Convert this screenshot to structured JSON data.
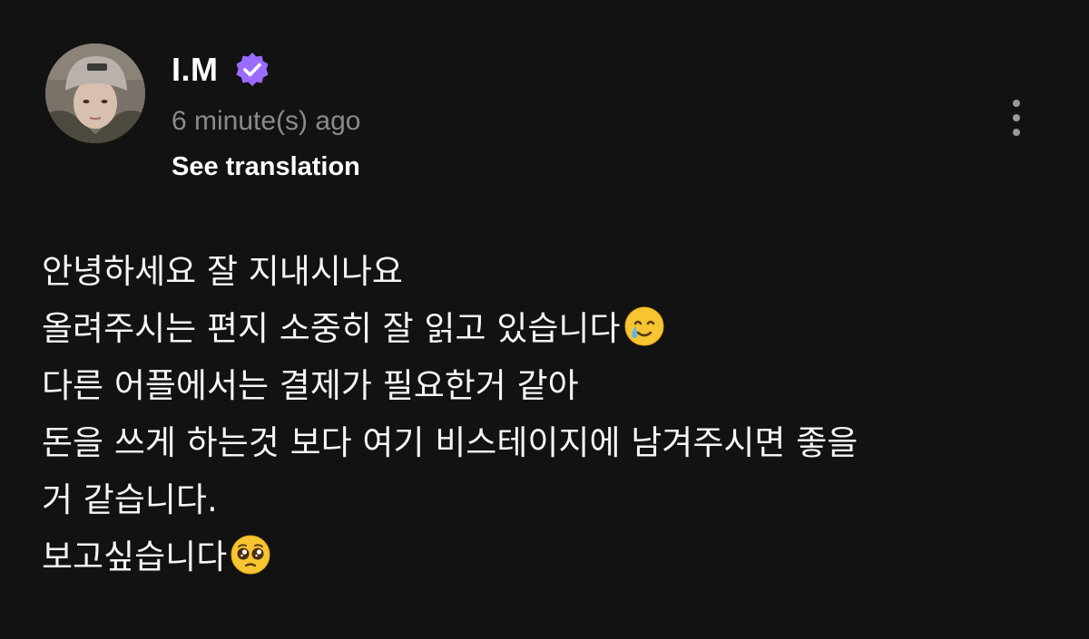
{
  "author": {
    "name": "I.M",
    "verified": true,
    "avatar_icon": "avatar-photo"
  },
  "post": {
    "timestamp": "6 minute(s) ago",
    "see_translation_label": "See translation",
    "lines": [
      "안녕하세요 잘 지내시나요",
      "올려주시는 편지 소중히 잘 읽고 있습니다",
      "다른 어플에서는 결제가 필요한거 같아",
      "돈을 쓰게 하는것 보다 여기 비스테이지에 남겨주시면 좋을",
      "거 같습니다.",
      "보고싶습니다"
    ],
    "line_emojis": {
      "1": "smiling-face-with-tear-emoji",
      "5": "pleading-face-emoji"
    }
  },
  "icons": {
    "verified": "verified-badge-icon",
    "more": "more-vertical-icon"
  },
  "colors": {
    "background": "#121212",
    "verified_badge": "#9a6bff",
    "timestamp": "#8a8a8a",
    "text": "#f5f5f5"
  }
}
